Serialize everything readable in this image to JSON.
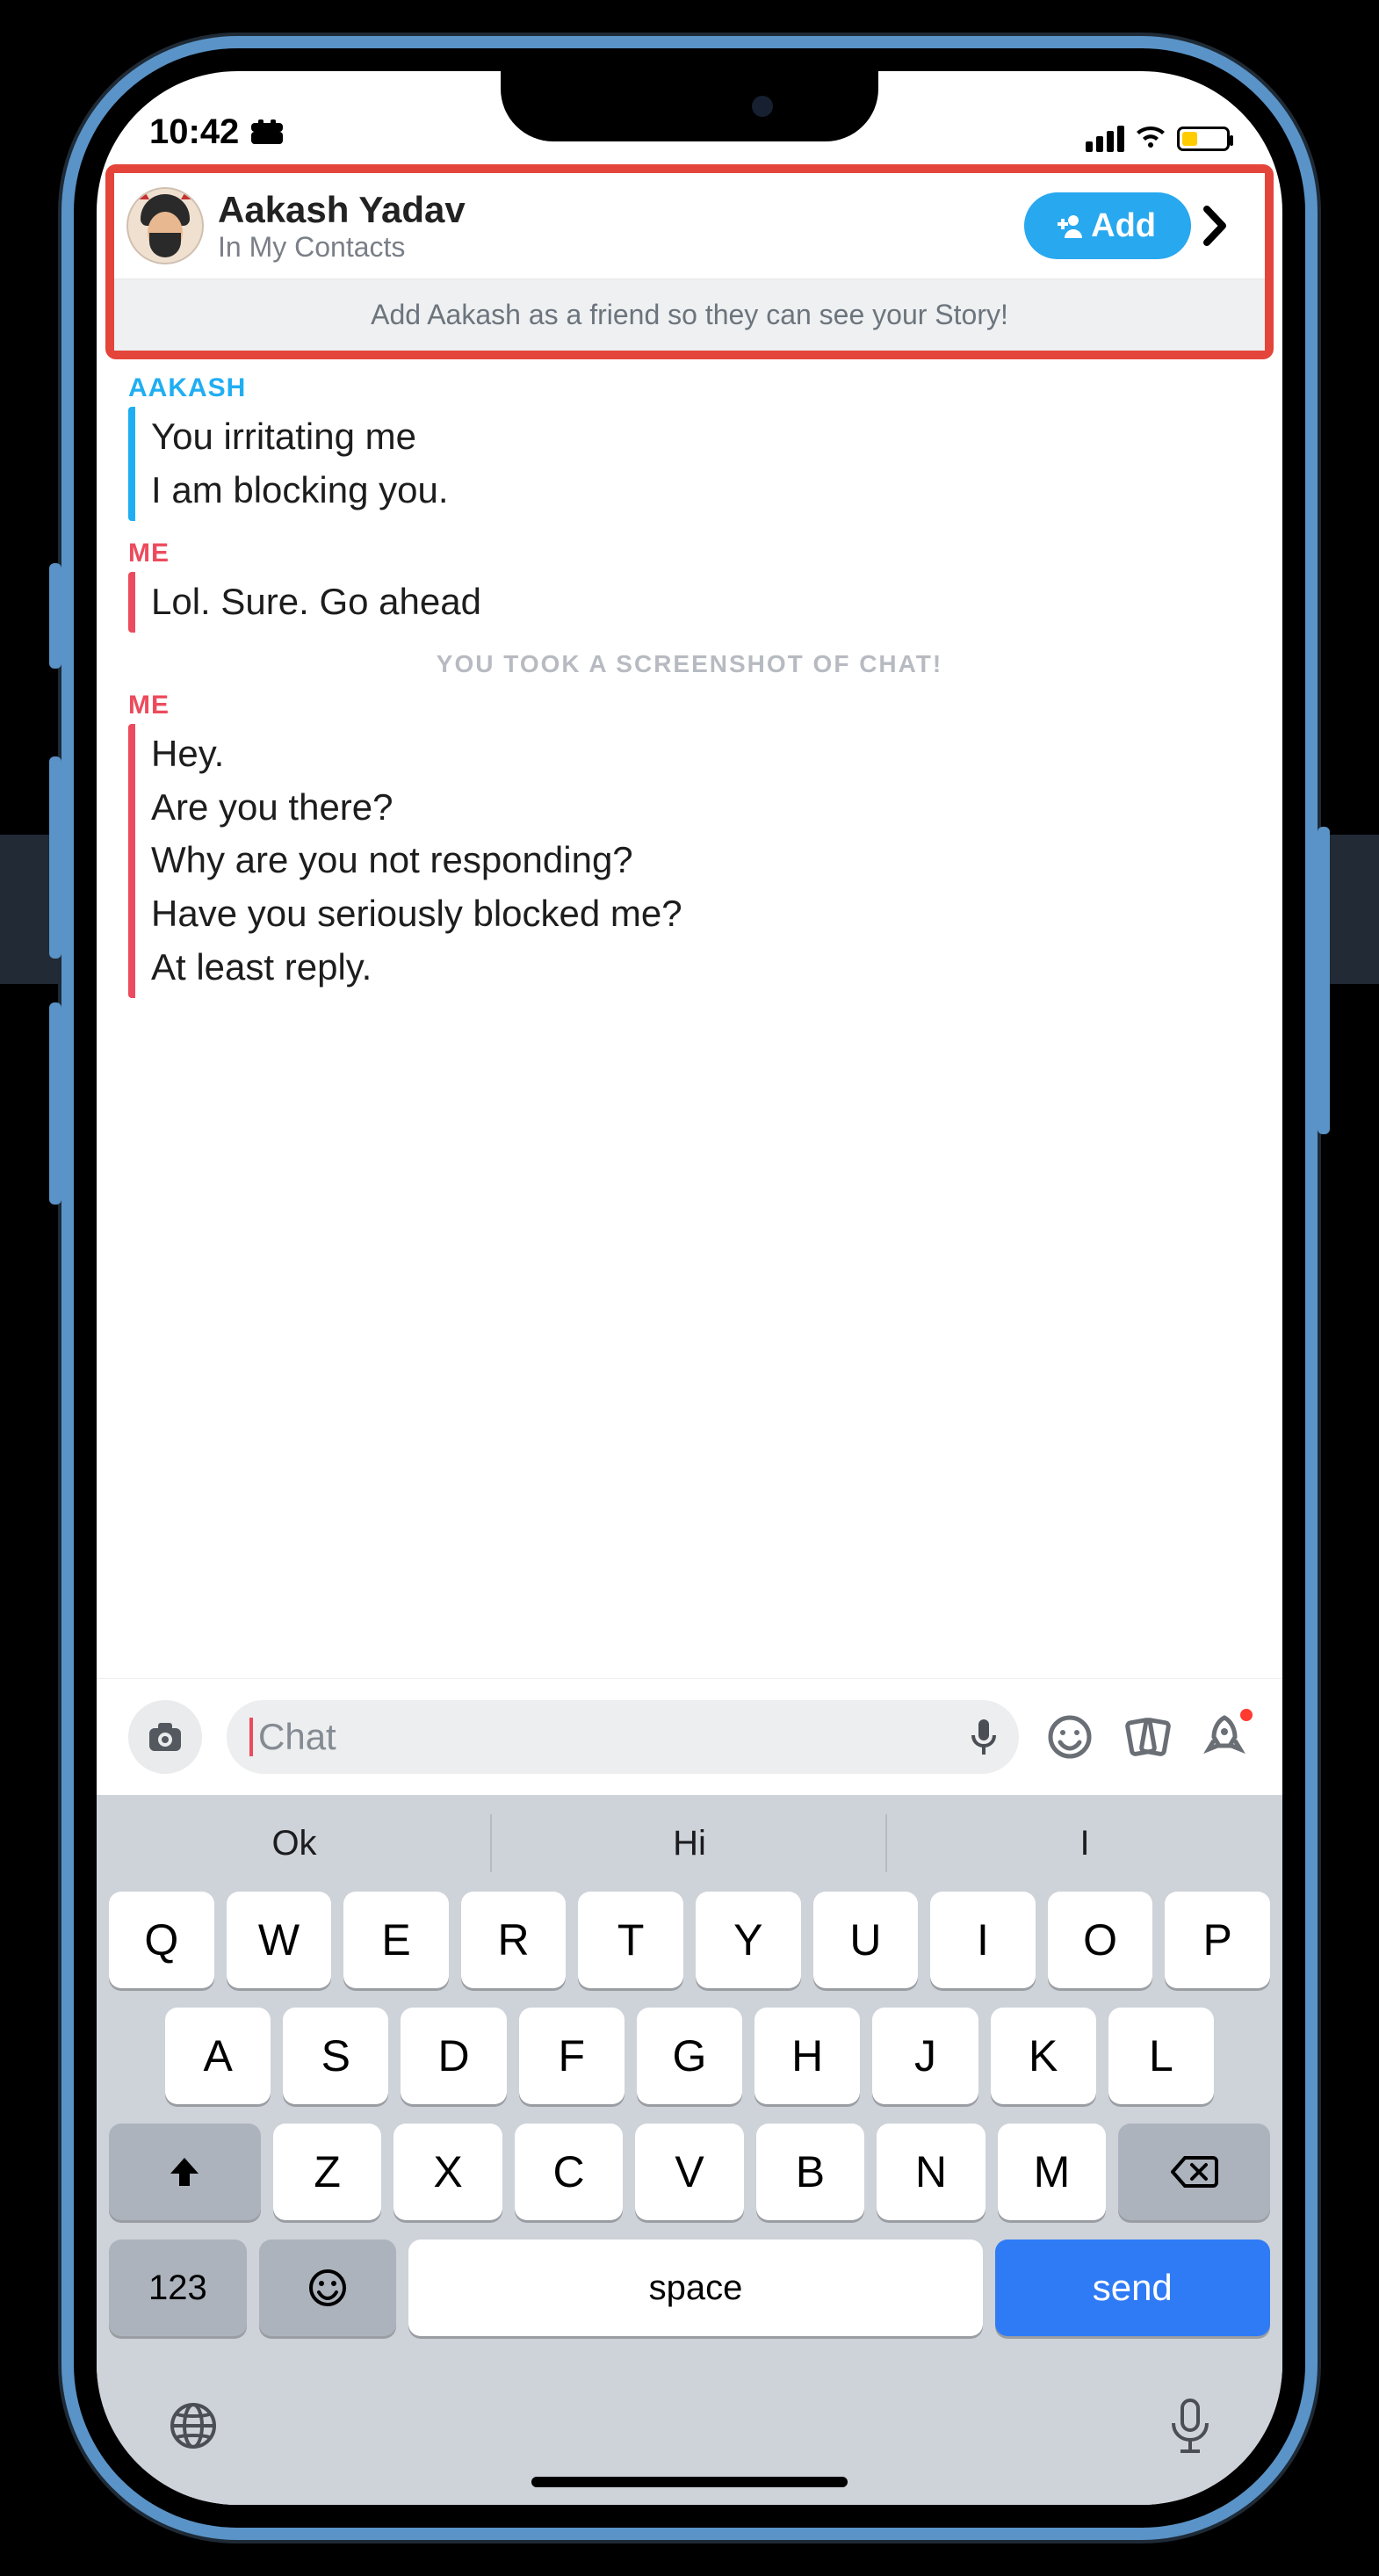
{
  "statusbar": {
    "time": "10:42"
  },
  "header": {
    "name": "Aakash Yadav",
    "subtitle": "In My Contacts",
    "add_label": "Add"
  },
  "banner": "Add Aakash as a friend so they can see your Story!",
  "chat": {
    "senders": {
      "other": "AAKASH",
      "me": "ME"
    },
    "block1": [
      "You irritating me",
      "I am blocking you."
    ],
    "block2": [
      "Lol. Sure. Go ahead"
    ],
    "system": "YOU TOOK A SCREENSHOT OF CHAT!",
    "block3": [
      "Hey.",
      "Are you there?",
      "Why are you not responding?",
      "Have you seriously blocked me?",
      "At least reply."
    ]
  },
  "input": {
    "placeholder": "Chat"
  },
  "predictions": [
    "Ok",
    "Hi",
    "I"
  ],
  "keyboard": {
    "row1": [
      "Q",
      "W",
      "E",
      "R",
      "T",
      "Y",
      "U",
      "I",
      "O",
      "P"
    ],
    "row2": [
      "A",
      "S",
      "D",
      "F",
      "G",
      "H",
      "J",
      "K",
      "L"
    ],
    "row3": [
      "Z",
      "X",
      "C",
      "V",
      "B",
      "N",
      "M"
    ],
    "numbers": "123",
    "space": "space",
    "send": "send"
  }
}
